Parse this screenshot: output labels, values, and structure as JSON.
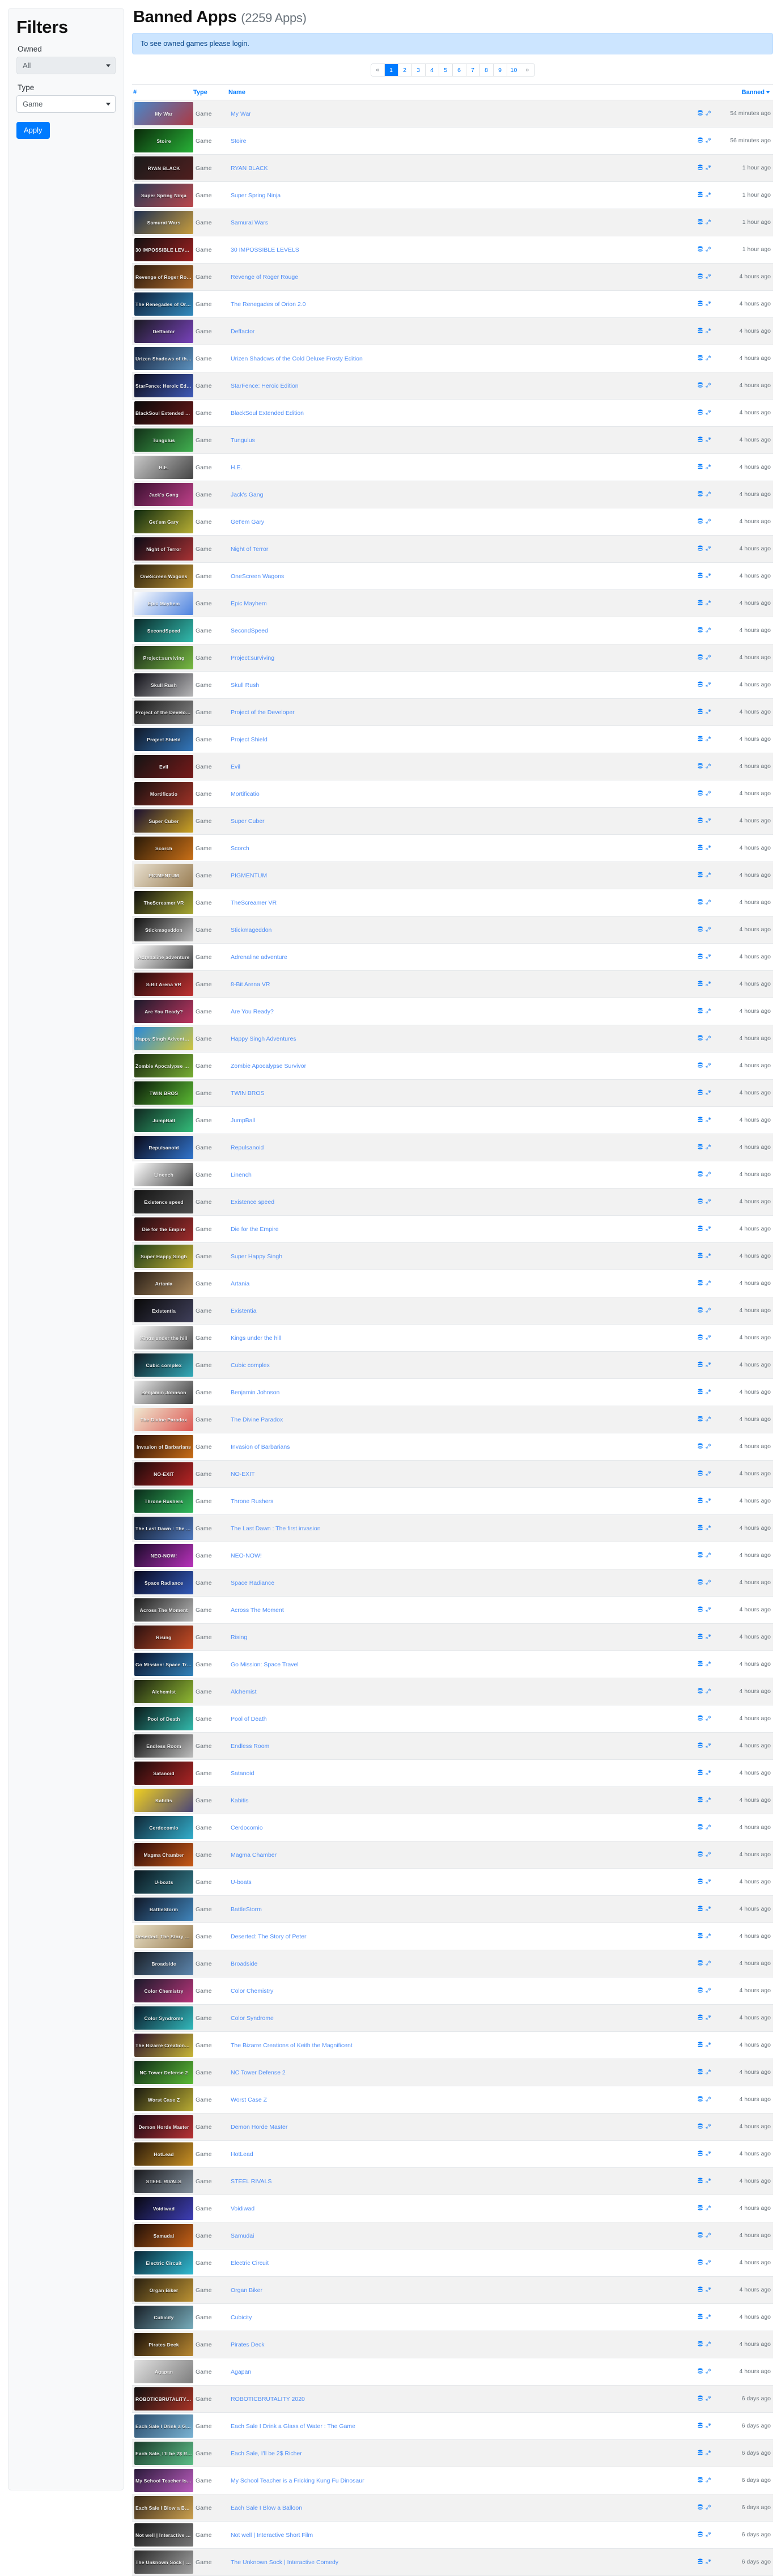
{
  "sidebar": {
    "title": "Filters",
    "owned_label": "Owned",
    "owned_value": "All",
    "type_label": "Type",
    "type_value": "Game",
    "apply_label": "Apply"
  },
  "header": {
    "title": "Banned Apps",
    "count": "(2259 Apps)",
    "alert": "To see owned games please login."
  },
  "pagination": {
    "prev": "«",
    "next": "»",
    "pages": [
      "1",
      "2",
      "3",
      "4",
      "5",
      "6",
      "7",
      "8",
      "9",
      "10"
    ],
    "active": "1"
  },
  "table": {
    "columns": {
      "num": "#",
      "type": "Type",
      "name": "Name",
      "icons": "",
      "banned": "Banned"
    },
    "icon_names": [
      "database-icon",
      "steam-icon"
    ],
    "rows": [
      {
        "type": "Game",
        "name": "My War",
        "banned": "54 minutes ago",
        "art": "#4a86c8",
        "art2": "#c02a2a"
      },
      {
        "type": "Game",
        "name": "Stoire",
        "banned": "56 minutes ago",
        "art": "#0a2a0a",
        "art2": "#2ecc40"
      },
      {
        "type": "Game",
        "name": "RYAN BLACK",
        "banned": "1 hour ago",
        "art": "#1a1a1a",
        "art2": "#5a2020"
      },
      {
        "type": "Game",
        "name": "Super Spring Ninja",
        "banned": "1 hour ago",
        "art": "#2b3a55",
        "art2": "#d84a4a"
      },
      {
        "type": "Game",
        "name": "Samurai Wars",
        "banned": "1 hour ago",
        "art": "#203050",
        "art2": "#e8b23a"
      },
      {
        "type": "Game",
        "name": "30 IMPOSSIBLE LEVELS",
        "banned": "1 hour ago",
        "art": "#111111",
        "art2": "#bb2222"
      },
      {
        "type": "Game",
        "name": "Revenge of Roger Rouge",
        "banned": "4 hours ago",
        "art": "#2a1a10",
        "art2": "#c87a30"
      },
      {
        "type": "Game",
        "name": "The Renegades of Orion 2.0",
        "banned": "4 hours ago",
        "art": "#10203a",
        "art2": "#3aa0d8"
      },
      {
        "type": "Game",
        "name": "Deffactor",
        "banned": "4 hours ago",
        "art": "#1a1a22",
        "art2": "#8a4ad8"
      },
      {
        "type": "Game",
        "name": "Urizen Shadows of the Cold Deluxe Frosty Edition",
        "banned": "4 hours ago",
        "art": "#15203a",
        "art2": "#6aa8d8"
      },
      {
        "type": "Game",
        "name": "StarFence: Heroic Edition",
        "banned": "4 hours ago",
        "art": "#0c0c18",
        "art2": "#4a6ad8"
      },
      {
        "type": "Game",
        "name": "BlackSoul Extended Edition",
        "banned": "4 hours ago",
        "art": "#0a0a0a",
        "art2": "#7a1a1a"
      },
      {
        "type": "Game",
        "name": "Tungulus",
        "banned": "4 hours ago",
        "art": "#123018",
        "art2": "#4ac85a"
      },
      {
        "type": "Game",
        "name": "H.E.",
        "banned": "4 hours ago",
        "art": "#c8c8c8",
        "art2": "#2a2a2a"
      },
      {
        "type": "Game",
        "name": "Jack's Gang",
        "banned": "4 hours ago",
        "art": "#3a1030",
        "art2": "#d84a9a"
      },
      {
        "type": "Game",
        "name": "Get'em Gary",
        "banned": "4 hours ago",
        "art": "#102a10",
        "art2": "#d8c83a"
      },
      {
        "type": "Game",
        "name": "Night of Terror",
        "banned": "4 hours ago",
        "art": "#0a0a14",
        "art2": "#c83a3a"
      },
      {
        "type": "Game",
        "name": "OneScreen Wagons",
        "banned": "4 hours ago",
        "art": "#2a2010",
        "art2": "#d8a83a"
      },
      {
        "type": "Game",
        "name": "Epic Mayhem",
        "banned": "4 hours ago",
        "art": "#ffffff",
        "art2": "#2a6ad8"
      },
      {
        "type": "Game",
        "name": "SecondSpeed",
        "banned": "4 hours ago",
        "art": "#0a2a2a",
        "art2": "#3ad8c8"
      },
      {
        "type": "Game",
        "name": "Project:surviving",
        "banned": "4 hours ago",
        "art": "#1a2a1a",
        "art2": "#8ad84a"
      },
      {
        "type": "Game",
        "name": "Skull Rush",
        "banned": "4 hours ago",
        "art": "#101018",
        "art2": "#d8d8d8"
      },
      {
        "type": "Game",
        "name": "Project of the Developer",
        "banned": "4 hours ago",
        "art": "#1a1a1a",
        "art2": "#9a9a9a"
      },
      {
        "type": "Game",
        "name": "Project Shield",
        "banned": "4 hours ago",
        "art": "#101828",
        "art2": "#3a8ad8"
      },
      {
        "type": "Game",
        "name": "Evil",
        "banned": "4 hours ago",
        "art": "#141414",
        "art2": "#8a1a1a"
      },
      {
        "type": "Game",
        "name": "Mortificatio",
        "banned": "4 hours ago",
        "art": "#181010",
        "art2": "#b8382a"
      },
      {
        "type": "Game",
        "name": "Super Cuber",
        "banned": "4 hours ago",
        "art": "#1a1030",
        "art2": "#f0c020"
      },
      {
        "type": "Game",
        "name": "Scorch",
        "banned": "4 hours ago",
        "art": "#2a1a08",
        "art2": "#e8801a"
      },
      {
        "type": "Game",
        "name": "PIGMENTUM",
        "banned": "4 hours ago",
        "art": "#e8e0d0",
        "art2": "#8a6a3a"
      },
      {
        "type": "Game",
        "name": "TheScreamer VR",
        "banned": "4 hours ago",
        "art": "#0f0f0f",
        "art2": "#c8c83a"
      },
      {
        "type": "Game",
        "name": "Stickmageddon",
        "banned": "4 hours ago",
        "art": "#101010",
        "art2": "#e0e0e0"
      },
      {
        "type": "Game",
        "name": "Adrenaline adventure",
        "banned": "4 hours ago",
        "art": "#ffffff",
        "art2": "#1a1a1a"
      },
      {
        "type": "Game",
        "name": "8-Bit Arena VR",
        "banned": "4 hours ago",
        "art": "#200a0a",
        "art2": "#e03a3a"
      },
      {
        "type": "Game",
        "name": "Are You Ready?",
        "banned": "4 hours ago",
        "art": "#1a1a2a",
        "art2": "#e03a6a"
      },
      {
        "type": "Game",
        "name": "Happy Singh Adventures",
        "banned": "4 hours ago",
        "art": "#2a8ad8",
        "art2": "#f0d020"
      },
      {
        "type": "Game",
        "name": "Zombie Apocalypse Survivor",
        "banned": "4 hours ago",
        "art": "#1a2a10",
        "art2": "#8ac83a"
      },
      {
        "type": "Game",
        "name": "TWIN BROS",
        "banned": "4 hours ago",
        "art": "#0a1a0a",
        "art2": "#6ad83a"
      },
      {
        "type": "Game",
        "name": "JumpBall",
        "banned": "4 hours ago",
        "art": "#102820",
        "art2": "#3ad88a"
      },
      {
        "type": "Game",
        "name": "Repulsanoid",
        "banned": "4 hours ago",
        "art": "#0a0a1a",
        "art2": "#3a8af0"
      },
      {
        "type": "Game",
        "name": "Linench",
        "banned": "4 hours ago",
        "art": "#ffffff",
        "art2": "#1a1a1a"
      },
      {
        "type": "Game",
        "name": "Existence speed",
        "banned": "4 hours ago",
        "art": "#141414",
        "art2": "#5a5a5a"
      },
      {
        "type": "Game",
        "name": "Die for the Empire",
        "banned": "4 hours ago",
        "art": "#1a1010",
        "art2": "#b83030"
      },
      {
        "type": "Game",
        "name": "Super Happy Singh",
        "banned": "4 hours ago",
        "art": "#1a3a1a",
        "art2": "#e8c83a"
      },
      {
        "type": "Game",
        "name": "Artania",
        "banned": "4 hours ago",
        "art": "#2a2018",
        "art2": "#c8a06a"
      },
      {
        "type": "Game",
        "name": "Existentia",
        "banned": "4 hours ago",
        "art": "#0a0a0a",
        "art2": "#4a4a6a"
      },
      {
        "type": "Game",
        "name": "Kings under the hill",
        "banned": "4 hours ago",
        "art": "#ffffff",
        "art2": "#2a2a2a"
      },
      {
        "type": "Game",
        "name": "Cubic complex",
        "banned": "4 hours ago",
        "art": "#101820",
        "art2": "#3ac8d8"
      },
      {
        "type": "Game",
        "name": "Benjamin Johnson",
        "banned": "4 hours ago",
        "art": "#e8e8e8",
        "art2": "#1a1a1a"
      },
      {
        "type": "Game",
        "name": "The Divine Paradox",
        "banned": "4 hours ago",
        "art": "#f0e8d0",
        "art2": "#d83a3a"
      },
      {
        "type": "Game",
        "name": "Invasion of Barbarians",
        "banned": "4 hours ago",
        "art": "#2a1008",
        "art2": "#e8801a"
      },
      {
        "type": "Game",
        "name": "NO-EXIT",
        "banned": "4 hours ago",
        "art": "#1a0a0a",
        "art2": "#d82a2a"
      },
      {
        "type": "Game",
        "name": "Throne Rushers",
        "banned": "4 hours ago",
        "art": "#0a2a1a",
        "art2": "#3ad86a"
      },
      {
        "type": "Game",
        "name": "The Last Dawn : The first invasion",
        "banned": "4 hours ago",
        "art": "#101828",
        "art2": "#5a8ad8"
      },
      {
        "type": "Game",
        "name": "NEO-NOW!",
        "banned": "4 hours ago",
        "art": "#1a0a2a",
        "art2": "#d83ad8"
      },
      {
        "type": "Game",
        "name": "Space Radiance",
        "banned": "4 hours ago",
        "art": "#0a0a20",
        "art2": "#3a6ad8"
      },
      {
        "type": "Game",
        "name": "Across The Moment",
        "banned": "4 hours ago",
        "art": "#1a1a1a",
        "art2": "#d8d8d8"
      },
      {
        "type": "Game",
        "name": "Rising",
        "banned": "4 hours ago",
        "art": "#2a1010",
        "art2": "#e85a2a"
      },
      {
        "type": "Game",
        "name": "Go Mission: Space Travel",
        "banned": "4 hours ago",
        "art": "#0a1028",
        "art2": "#3a9ad8"
      },
      {
        "type": "Game",
        "name": "Alchemist",
        "banned": "4 hours ago",
        "art": "#1a2010",
        "art2": "#a8d83a"
      },
      {
        "type": "Game",
        "name": "Pool of Death",
        "banned": "4 hours ago",
        "art": "#0a1a1a",
        "art2": "#3ad8c8"
      },
      {
        "type": "Game",
        "name": "Endless Room",
        "banned": "4 hours ago",
        "art": "#101010",
        "art2": "#e0e0e0"
      },
      {
        "type": "Game",
        "name": "Satanoid",
        "banned": "4 hours ago",
        "art": "#1a0a0a",
        "art2": "#c82a2a"
      },
      {
        "type": "Game",
        "name": "Kabitis",
        "banned": "4 hours ago",
        "art": "#f0d020",
        "art2": "#2a2a8a"
      },
      {
        "type": "Game",
        "name": "Cerdocomio",
        "banned": "4 hours ago",
        "art": "#102838",
        "art2": "#3ac8e8"
      },
      {
        "type": "Game",
        "name": "Magma Chamber",
        "banned": "4 hours ago",
        "art": "#2a0a0a",
        "art2": "#e86a1a"
      },
      {
        "type": "Game",
        "name": "U-boats",
        "banned": "4 hours ago",
        "art": "#0a1820",
        "art2": "#3a8a9a"
      },
      {
        "type": "Game",
        "name": "BattleStorm",
        "banned": "4 hours ago",
        "art": "#101828",
        "art2": "#4a9ad8"
      },
      {
        "type": "Game",
        "name": "Deserted: The Story of Peter",
        "banned": "4 hours ago",
        "art": "#e8e0c8",
        "art2": "#8a6a3a"
      },
      {
        "type": "Game",
        "name": "Broadside",
        "banned": "4 hours ago",
        "art": "#1a2028",
        "art2": "#6a9ac8"
      },
      {
        "type": "Game",
        "name": "Color Chemistry",
        "banned": "4 hours ago",
        "art": "#1a1a2a",
        "art2": "#d83a8a"
      },
      {
        "type": "Game",
        "name": "Color Syndrome",
        "banned": "4 hours ago",
        "art": "#0a1a2a",
        "art2": "#3ad8d8"
      },
      {
        "type": "Game",
        "name": "The Bizarre Creations of Keith the Magnificent",
        "banned": "4 hours ago",
        "art": "#2a102a",
        "art2": "#e8d83a"
      },
      {
        "type": "Game",
        "name": "NC Tower Defense 2",
        "banned": "4 hours ago",
        "art": "#102818",
        "art2": "#6ad83a"
      },
      {
        "type": "Game",
        "name": "Worst Case Z",
        "banned": "4 hours ago",
        "art": "#1a1a10",
        "art2": "#d8c83a"
      },
      {
        "type": "Game",
        "name": "Demon Horde Master",
        "banned": "4 hours ago",
        "art": "#1a0a14",
        "art2": "#d83a3a"
      },
      {
        "type": "Game",
        "name": "HotLead",
        "banned": "4 hours ago",
        "art": "#2a1a0a",
        "art2": "#e8a82a"
      },
      {
        "type": "Game",
        "name": "STEEL RIVALS",
        "banned": "4 hours ago",
        "art": "#18181c",
        "art2": "#9aaab8"
      },
      {
        "type": "Game",
        "name": "Voidiwad",
        "banned": "4 hours ago",
        "art": "#080810",
        "art2": "#4a4ad8"
      },
      {
        "type": "Game",
        "name": "Samudai",
        "banned": "4 hours ago",
        "art": "#201008",
        "art2": "#e8721a"
      },
      {
        "type": "Game",
        "name": "Electric Circuit",
        "banned": "4 hours ago",
        "art": "#0a2838",
        "art2": "#3ad8f0"
      },
      {
        "type": "Game",
        "name": "Organ Biker",
        "banned": "4 hours ago",
        "art": "#2a2010",
        "art2": "#d8a83a"
      },
      {
        "type": "Game",
        "name": "Cubicity",
        "banned": "4 hours ago",
        "art": "#182028",
        "art2": "#8ac8d8"
      },
      {
        "type": "Game",
        "name": "Pirates Deck",
        "banned": "4 hours ago",
        "art": "#1a1008",
        "art2": "#d8a03a"
      },
      {
        "type": "Game",
        "name": "Agapan",
        "banned": "4 hours ago",
        "art": "#e0e0e0",
        "art2": "#6a6a6a"
      },
      {
        "type": "Game",
        "name": "ROBOTICBRUTALITY 2020",
        "banned": "6 days ago",
        "art": "#101010",
        "art2": "#c83a2a"
      },
      {
        "type": "Game",
        "name": "Each Sale I Drink a Glass of Water : The Game",
        "banned": "6 days ago",
        "art": "#2a4a6a",
        "art2": "#8ac8e8"
      },
      {
        "type": "Game",
        "name": "Each Sale, I'll be 2$ Richer",
        "banned": "6 days ago",
        "art": "#1a3a2a",
        "art2": "#6ad89a"
      },
      {
        "type": "Game",
        "name": "My School Teacher is a Fricking Kung Fu Dinosaur",
        "banned": "6 days ago",
        "art": "#2a1a3a",
        "art2": "#d86ad8"
      },
      {
        "type": "Game",
        "name": "Each Sale I Blow a Balloon",
        "banned": "6 days ago",
        "art": "#3a2a1a",
        "art2": "#e8b85a"
      },
      {
        "type": "Game",
        "name": "Not well | Interactive Short Film",
        "banned": "6 days ago",
        "art": "#1a1a1a",
        "art2": "#8a8a8a"
      },
      {
        "type": "Game",
        "name": "The Unknown Sock | Interactive Comedy",
        "banned": "6 days ago",
        "art": "#2a2a2a",
        "art2": "#b8b8b8"
      }
    ]
  }
}
